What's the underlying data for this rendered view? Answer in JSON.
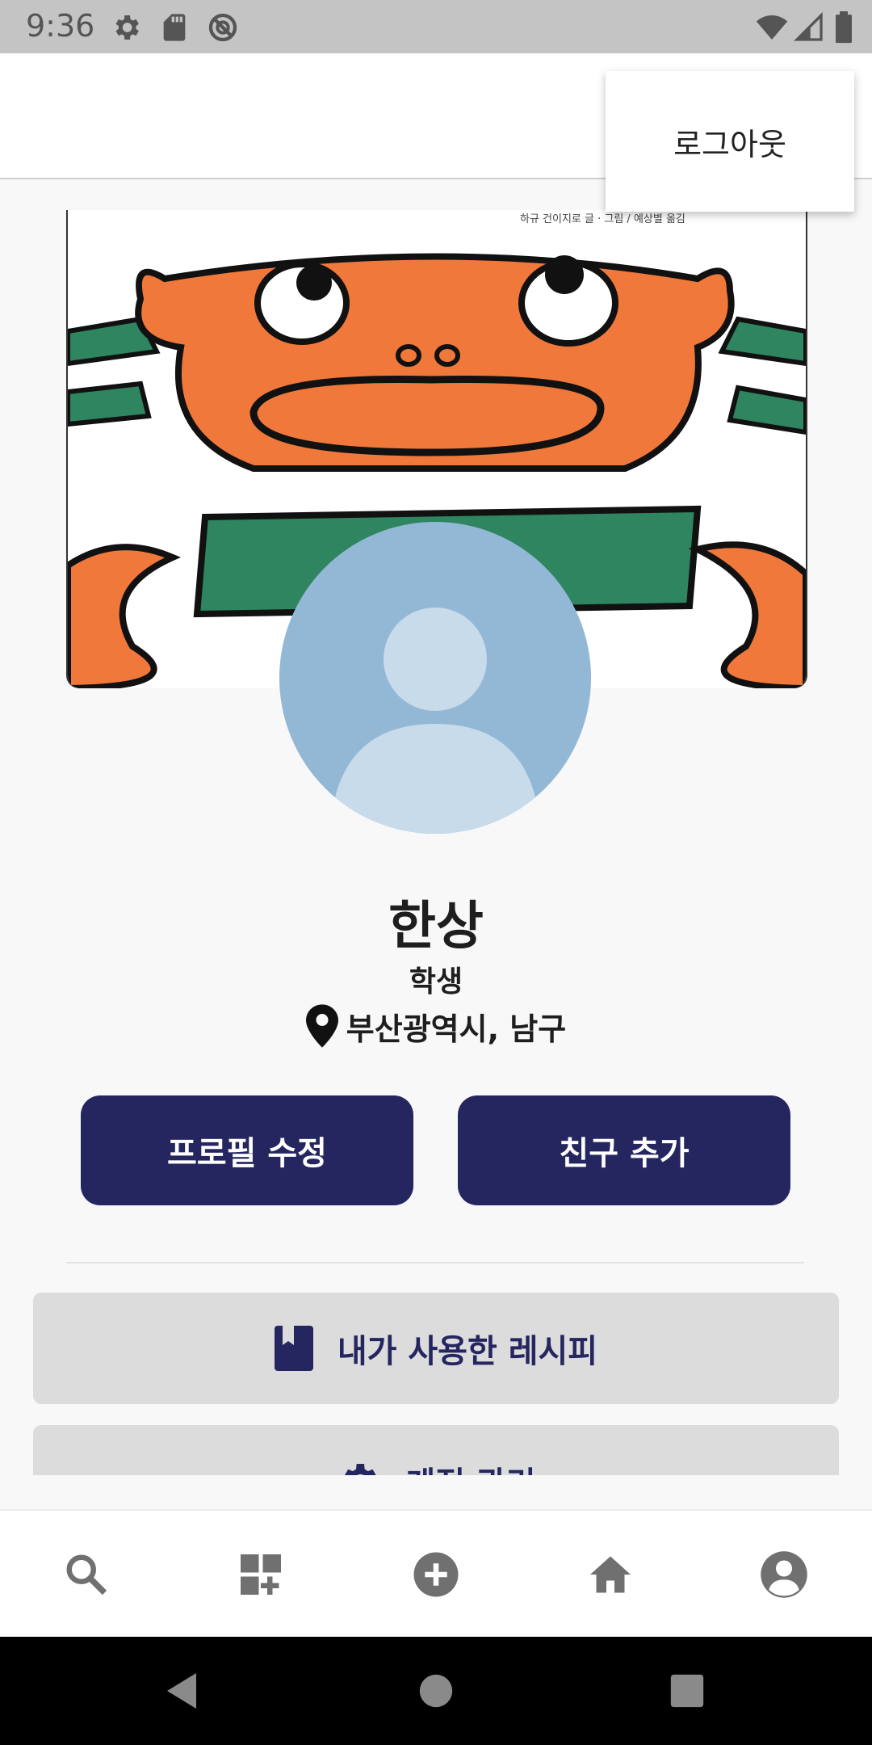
{
  "status_bar": {
    "time": "9:36",
    "icons": [
      "settings-gear-icon",
      "sd-card-icon",
      "sync-blocked-icon",
      "wifi-icon",
      "signal-icon",
      "battery-icon"
    ]
  },
  "menu": {
    "logout_label": "로그아웃"
  },
  "cover": {
    "caption": "하규 건이지로 글 · 그림 / 예상별 옮김"
  },
  "profile": {
    "name": "한상",
    "role": "학생",
    "location": "부산광역시, 남구"
  },
  "actions": {
    "edit_profile": "프로필 수정",
    "add_friend": "친구 추가"
  },
  "menu_list": {
    "items": [
      {
        "label": "내가 사용한 레시피",
        "icon": "bookmark-book-icon"
      },
      {
        "label": "계정 관리",
        "icon": "gear-icon"
      }
    ]
  },
  "bottom_nav": {
    "items": [
      "search-icon",
      "add-widget-icon",
      "add-circle-icon",
      "home-icon",
      "account-circle-icon"
    ],
    "active": "account-circle-icon"
  },
  "colors": {
    "primary": "#252660",
    "card_bg": "#dcdcdc",
    "avatar_bg": "#93b8d6",
    "status_bar_bg": "#c4c4c4"
  }
}
